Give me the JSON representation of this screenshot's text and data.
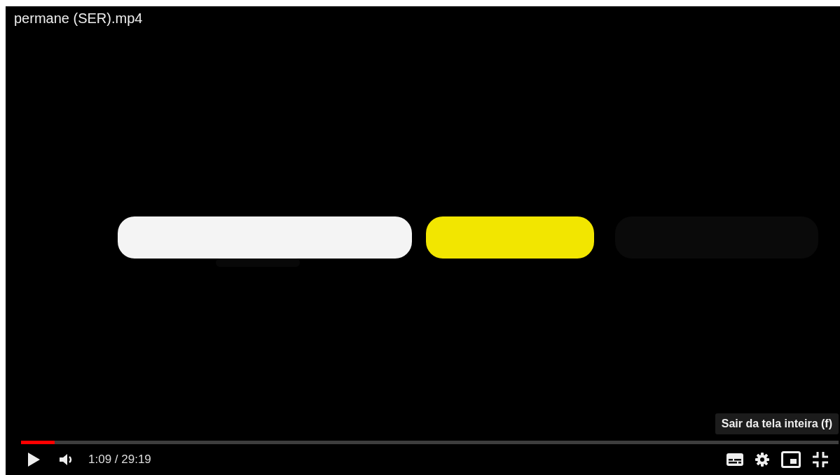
{
  "video": {
    "title": "permane (SER).mp4"
  },
  "tooltip": "Sair da tela inteira (f)",
  "progress": {
    "level": 0.041
  },
  "time": "1:09 / 29:19"
}
